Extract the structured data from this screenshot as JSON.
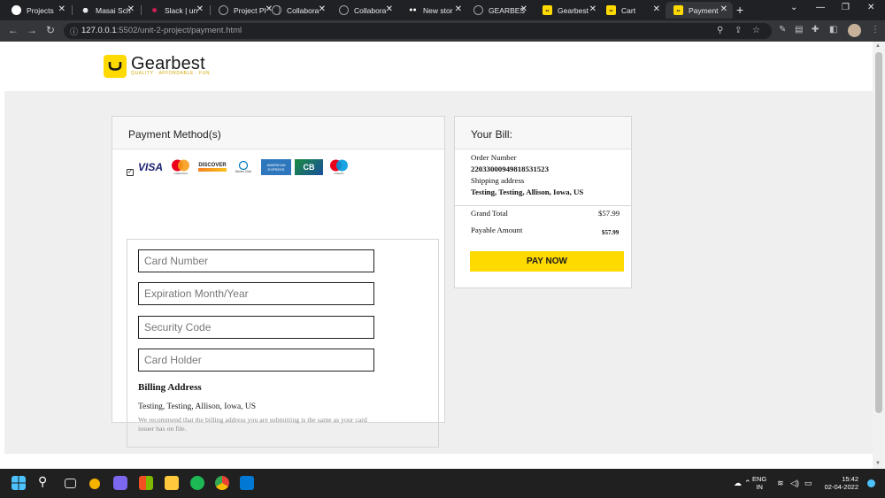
{
  "browser": {
    "tabs": [
      {
        "title": "Projects",
        "favicon": "github-icon",
        "color": "#ffffff"
      },
      {
        "title": "Masai Sch",
        "favicon": "masai-icon",
        "color": "#e8eaed"
      },
      {
        "title": "Slack | un",
        "favicon": "slack-icon",
        "color": "#e01e5a"
      },
      {
        "title": "Project Pl",
        "favicon": "globe-icon",
        "color": "#9aa0a6"
      },
      {
        "title": "Collabora",
        "favicon": "globe-icon",
        "color": "#9aa0a6"
      },
      {
        "title": "Collabora",
        "favicon": "globe-icon",
        "color": "#9aa0a6"
      },
      {
        "title": "New stor",
        "favicon": "medium-icon",
        "color": "#ffffff"
      },
      {
        "title": "GEARBES",
        "favicon": "globe-icon",
        "color": "#9aa0a6"
      },
      {
        "title": "Gearbest",
        "favicon": "gearbest-icon",
        "color": "#ffda00"
      },
      {
        "title": "Cart",
        "favicon": "gearbest-icon",
        "color": "#ffda00"
      },
      {
        "title": "Payment",
        "favicon": "gearbest-icon",
        "color": "#ffda00"
      }
    ],
    "url_host": "127.0.0.1",
    "url_rest": ":5502/unit-2-project/payment.html"
  },
  "site": {
    "brand": "Gearbest",
    "tagline": "QUALITY · AFFORDABLE · FUN"
  },
  "payment": {
    "title": "Payment Method(s)",
    "card_brands": [
      "VISA",
      "mastercard",
      "DISCOVER",
      "Diners Club",
      "AMERICAN EXPRESS",
      "CB",
      "maestro"
    ],
    "fields": [
      {
        "placeholder": "Card Number"
      },
      {
        "placeholder": "Expiration Month/Year"
      },
      {
        "placeholder": "Security Code"
      },
      {
        "placeholder": "Card Holder"
      }
    ],
    "billing_title": "Billing Address",
    "billing_address": "Testing, Testing, Allison, Iowa, US",
    "billing_note": "We recommend that the billing address you are submitting is the same as your card issuer has on file."
  },
  "bill": {
    "title": "Your Bill:",
    "order_label": "Order Number",
    "order_number": "22033000949818531523",
    "shipping_label": "Shipping address",
    "shipping_address": "Testing, Testing, Allison, Iowa, US",
    "grand_total_label": "Grand Total",
    "grand_total": "$57.99",
    "payable_label": "Payable Amount",
    "payable": "$57.99",
    "pay_button": "PAY NOW"
  },
  "taskbar": {
    "lang_top": "ENG",
    "lang_bottom": "IN",
    "time": "15:42",
    "date": "02-04-2022"
  }
}
